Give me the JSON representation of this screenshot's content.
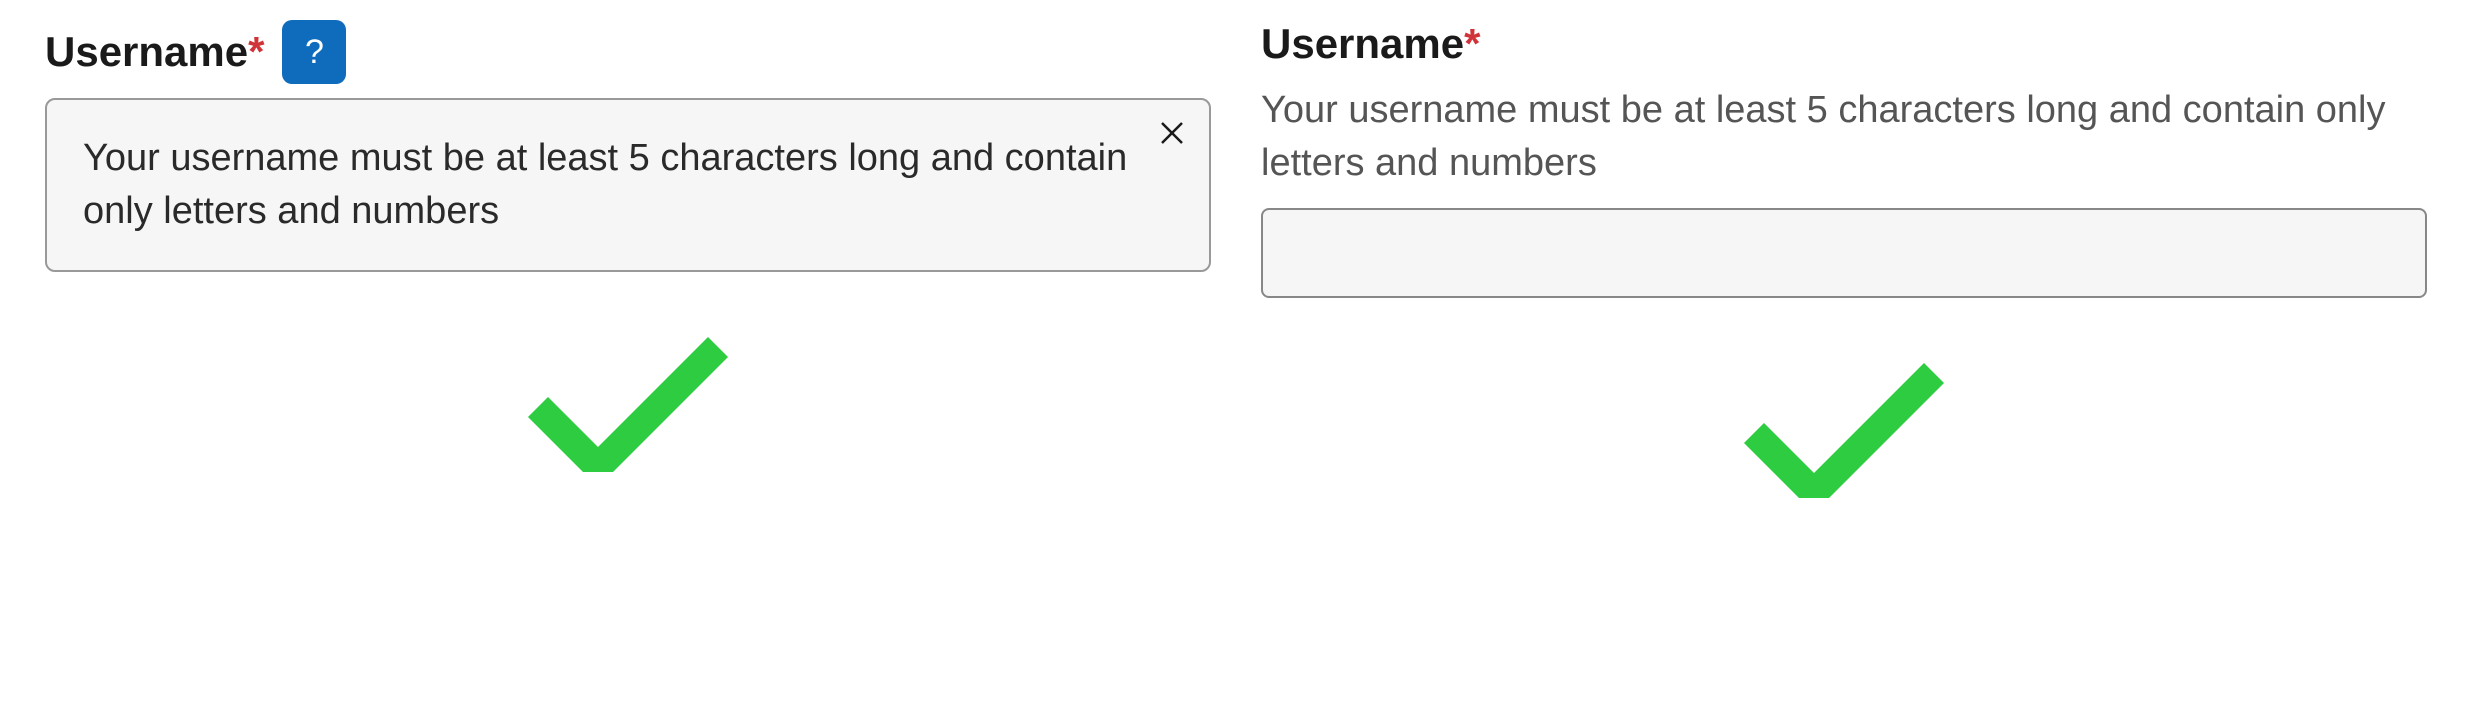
{
  "example_left": {
    "label": "Username",
    "required_mark": "*",
    "help_button": "?",
    "tooltip_text": "Your username must be at least 5 characters long and contain only letters and numbers"
  },
  "example_right": {
    "label": "Username",
    "required_mark": "*",
    "helper_text": "Your username must be at least 5 characters long and contain only letters and numbers",
    "input_value": ""
  }
}
